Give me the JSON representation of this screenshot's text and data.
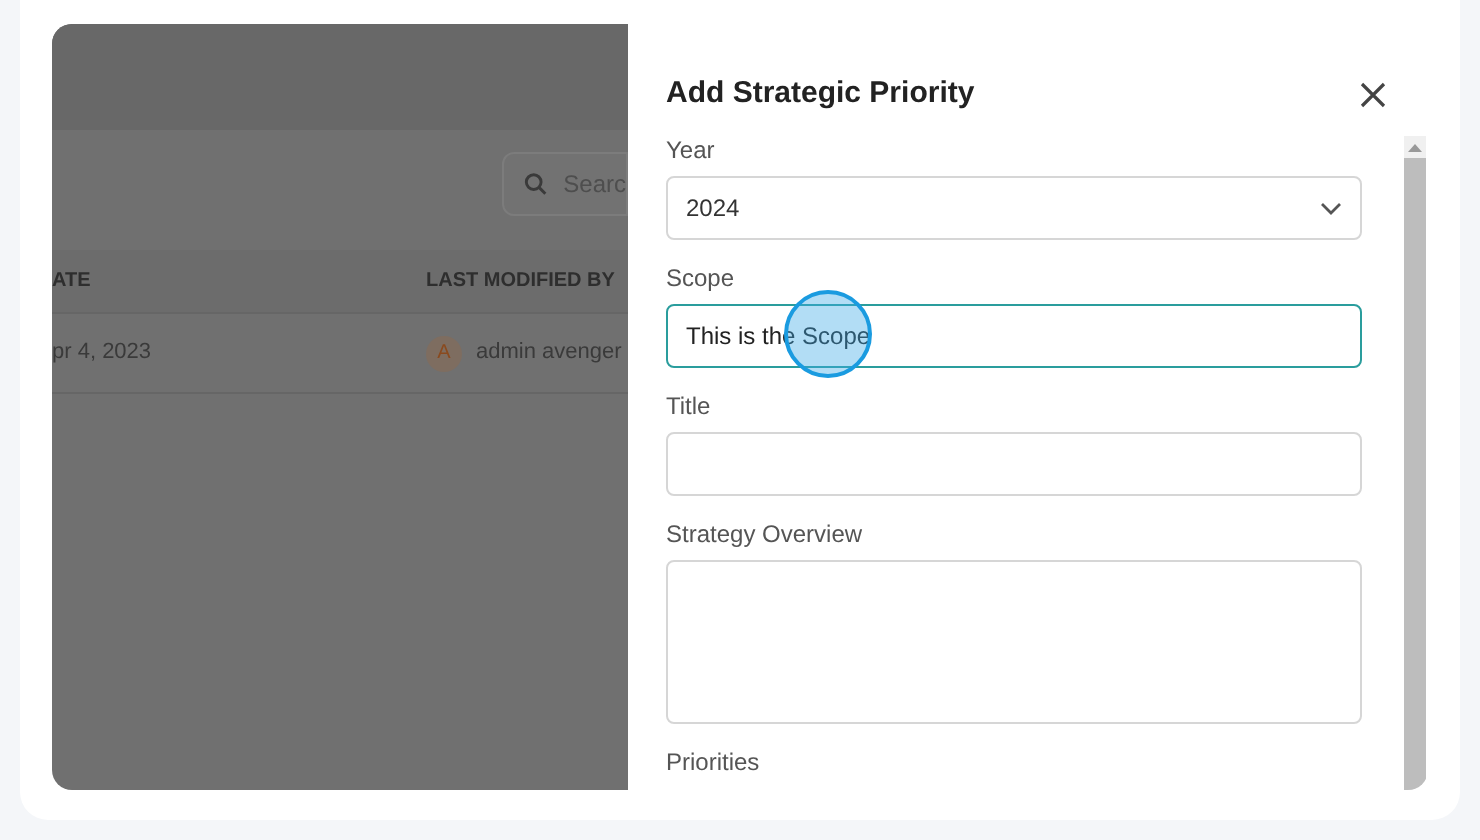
{
  "background": {
    "search": {
      "placeholder": "Searc"
    },
    "table": {
      "columns": [
        "ATE",
        "LAST MODIFIED BY"
      ],
      "rows": [
        {
          "date": "pr 4, 2023",
          "avatar": "A",
          "modified_by": "admin avenger"
        }
      ]
    }
  },
  "dialog": {
    "title": "Add Strategic Priority",
    "fields": [
      {
        "label": "Year",
        "kind": "select",
        "value": "2024",
        "focused": false
      },
      {
        "label": "Scope",
        "kind": "text",
        "value": "This is the Scope",
        "focused": true
      },
      {
        "label": "Title",
        "kind": "text",
        "focused": false
      },
      {
        "label": "Strategy Overview",
        "kind": "textarea",
        "focused": false
      },
      {
        "label": "Priorities",
        "kind": "label"
      }
    ]
  }
}
